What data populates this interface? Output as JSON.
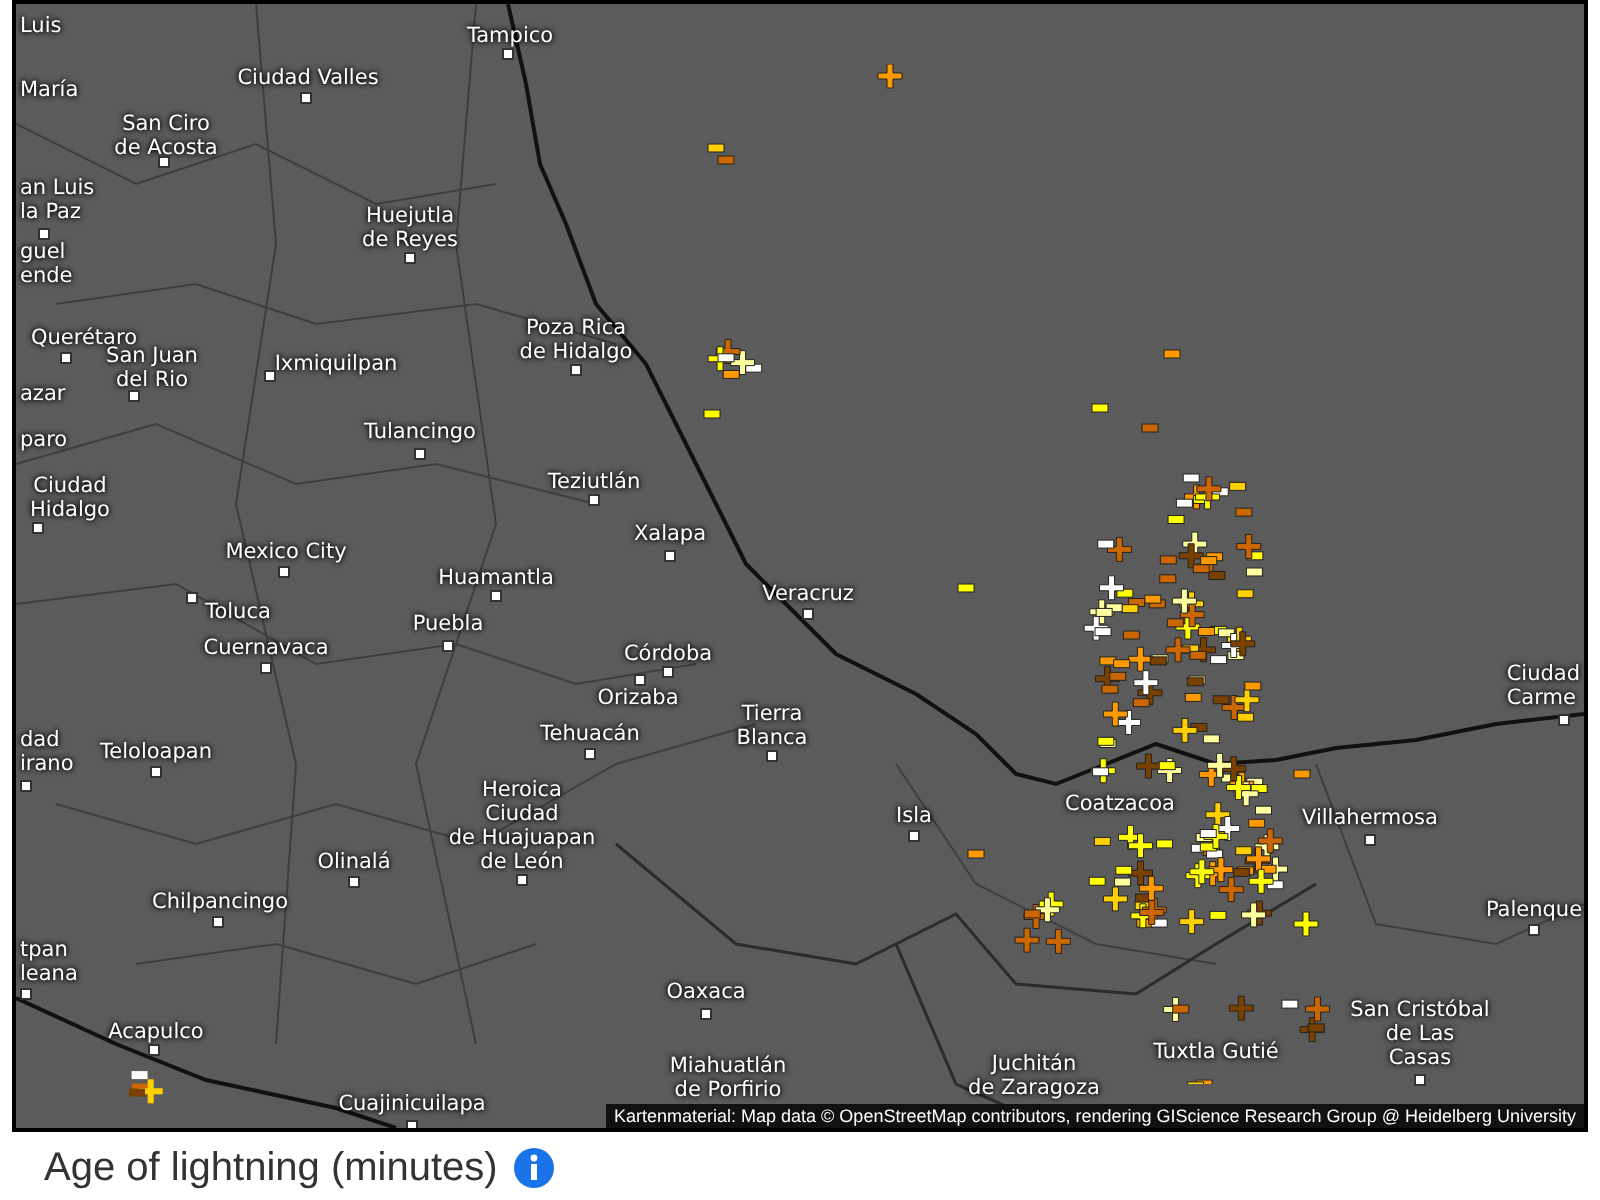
{
  "map": {
    "places": [
      {
        "name": "Luis"
      },
      {
        "name": "María"
      },
      {
        "name": "Tampico"
      },
      {
        "name": "Ciudad Valles"
      },
      {
        "name": "San Ciro\nde Acosta"
      },
      {
        "name": "an Luis\nla Paz"
      },
      {
        "name": "guel\nende"
      },
      {
        "name": "Huejutla\nde Reyes"
      },
      {
        "name": "Querétaro"
      },
      {
        "name": "San Juan\ndel Rio"
      },
      {
        "name": "Ixmiquilpan"
      },
      {
        "name": "Poza Rica\nde Hidalgo"
      },
      {
        "name": "azar"
      },
      {
        "name": "paro"
      },
      {
        "name": "Tulancingo"
      },
      {
        "name": "Ciudad\nHidalgo"
      },
      {
        "name": "Teziutlán"
      },
      {
        "name": "Xalapa"
      },
      {
        "name": "Mexico City"
      },
      {
        "name": "Huamantla"
      },
      {
        "name": "Toluca"
      },
      {
        "name": "Veracruz"
      },
      {
        "name": "Puebla"
      },
      {
        "name": "Cuernavaca"
      },
      {
        "name": "Córdoba"
      },
      {
        "name": "Orizaba"
      },
      {
        "name": "Tierra\nBlanca"
      },
      {
        "name": "Ciudad\nCarme"
      },
      {
        "name": "dad\nirano"
      },
      {
        "name": "Teloloapan"
      },
      {
        "name": "Tehuacán"
      },
      {
        "name": "Olinalá"
      },
      {
        "name": "Heroica\nCiudad\nde Huajuapan\nde León"
      },
      {
        "name": "Isla"
      },
      {
        "name": "Coatzacoa"
      },
      {
        "name": "Villahermosa"
      },
      {
        "name": "Chilpancingo"
      },
      {
        "name": "Palenque"
      },
      {
        "name": "tpan\nleana"
      },
      {
        "name": "Oaxaca"
      },
      {
        "name": "Acapulco"
      },
      {
        "name": "Tuxtla Gutié"
      },
      {
        "name": "San Cristóbal\nde Las\nCasas"
      },
      {
        "name": "Cuajinicuilapa"
      },
      {
        "name": "Miahuatlán\nde Porfirio"
      },
      {
        "name": "Juchitán\nde Zaragoza"
      }
    ],
    "attribution": "Kartenmaterial: Map data © OpenStreetMap contributors, rendering GIScience Research Group @ Heidelberg University"
  },
  "legend": {
    "title": "Age of lightning (minutes)"
  }
}
